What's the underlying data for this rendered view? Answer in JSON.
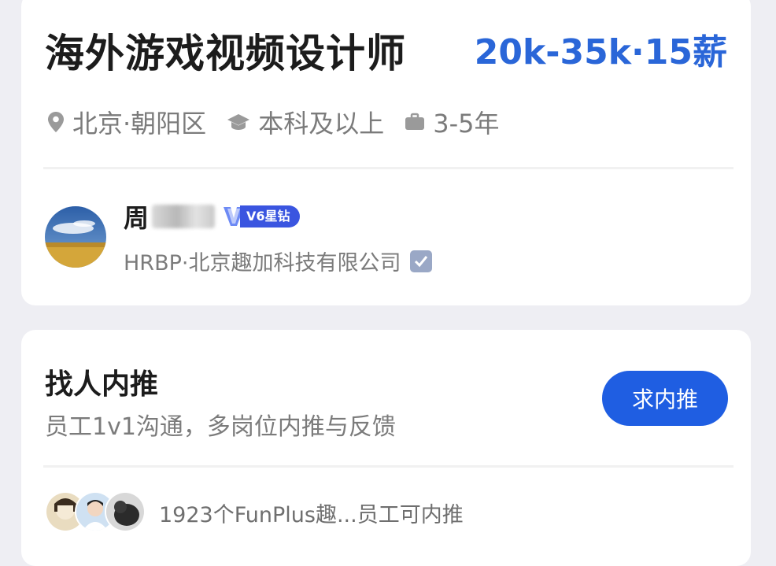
{
  "job": {
    "title": "海外游戏视频设计师",
    "salary": "20k-35k·15薪",
    "location": "北京·朝阳区",
    "education": "本科及以上",
    "experience": "3-5年",
    "icons": [
      "location-pin-icon",
      "graduation-cap-icon",
      "briefcase-icon"
    ]
  },
  "recruiter": {
    "name_visible": "周",
    "badge": "V6星钻",
    "company": "HRBP·北京趣加科技有限公司",
    "verified": true
  },
  "referral": {
    "title": "找人内推",
    "subtitle": "员工1v1沟通，多岗位内推与反馈",
    "button_label": "求内推",
    "employees_text": "1923个FunPlus趣...员工可内推"
  },
  "colors": {
    "accent": "#2a66d8",
    "button": "#1f5ee2",
    "badge": "#3a55e0",
    "muted_text": "#7b7b7b"
  }
}
